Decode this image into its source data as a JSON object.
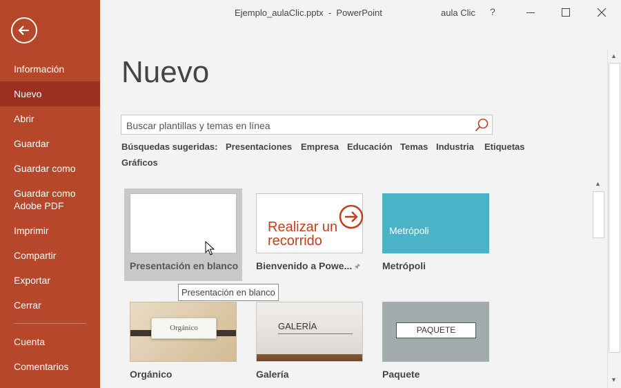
{
  "titlebar": {
    "title": "Ejemplo_aulaClic.pptx  -  PowerPoint",
    "user": "aula Clic",
    "help": "?"
  },
  "sidebar": {
    "items": [
      {
        "label": "Información"
      },
      {
        "label": "Nuevo"
      },
      {
        "label": "Abrir"
      },
      {
        "label": "Guardar"
      },
      {
        "label": "Guardar como"
      },
      {
        "label": "Guardar como Adobe PDF"
      },
      {
        "label": "Imprimir"
      },
      {
        "label": "Compartir"
      },
      {
        "label": "Exportar"
      },
      {
        "label": "Cerrar"
      },
      {
        "label": "Cuenta"
      },
      {
        "label": "Comentarios"
      }
    ],
    "active": "Nuevo"
  },
  "main": {
    "heading": "Nuevo",
    "search": {
      "placeholder": "Buscar plantillas y temas en línea"
    },
    "suggested": {
      "label": "Búsquedas sugeridas:",
      "links": [
        "Presentaciones",
        "Empresa",
        "Educación",
        "Temas",
        "Industria",
        "Etiquetas",
        "Gráficos"
      ]
    },
    "templates": [
      {
        "label": "Presentación en blanco"
      },
      {
        "label": "Bienvenido a Powe...",
        "thumb_text_1": "Realizar un",
        "thumb_text_2": "recorrido"
      },
      {
        "label": "Metrópoli",
        "thumb_text": "Metrópoli"
      },
      {
        "label": "Orgánico",
        "thumb_text": "Orgánico"
      },
      {
        "label": "Galería",
        "thumb_text": "GALERÍA"
      },
      {
        "label": "Paquete",
        "thumb_text": "PAQUETE"
      }
    ],
    "tooltip": "Presentación en blanco"
  },
  "colors": {
    "sidebar": "#b7472a",
    "sidebar_active": "#9c3020",
    "accent": "#d24726",
    "metropoli": "#4bb3c8"
  }
}
